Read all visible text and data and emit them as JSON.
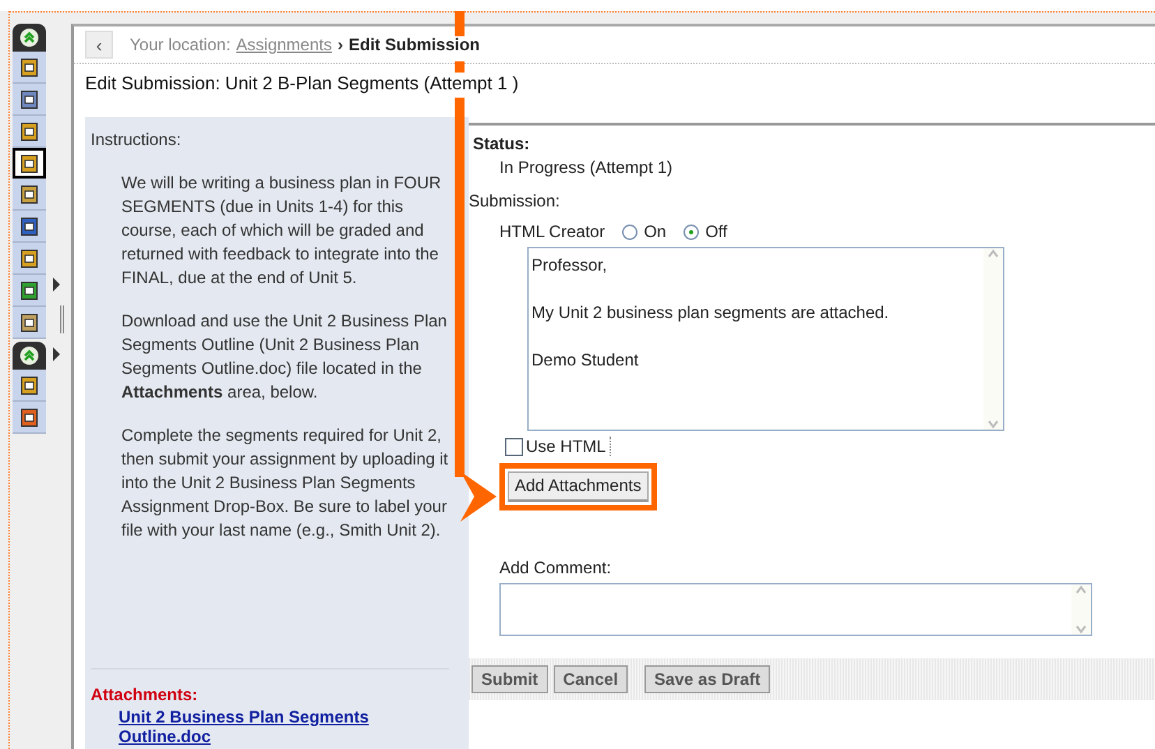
{
  "sidebar": {
    "groups": [
      {
        "items": [
          {
            "selected": false
          },
          {
            "selected": false
          },
          {
            "selected": false
          },
          {
            "selected": true
          },
          {
            "selected": false
          },
          {
            "selected": false
          },
          {
            "selected": false
          },
          {
            "selected": false
          },
          {
            "selected": false
          }
        ]
      },
      {
        "items": [
          {
            "selected": false
          },
          {
            "selected": false
          }
        ]
      }
    ]
  },
  "breadcrumb": {
    "back": "‹",
    "label": "Your location:",
    "link": "Assignments",
    "separator": "›",
    "current": "Edit Submission"
  },
  "page_title": "Edit Submission: Unit 2 B-Plan Segments (Attempt 1 )",
  "instructions": {
    "heading": "Instructions:",
    "paragraphs": [
      "We will be writing a business plan in FOUR SEGMENTS (due in Units 1-4) for this course, each of which will be graded and returned with feedback to integrate into the FINAL, due at the end of Unit 5.",
      "Download and use the Unit 2 Business Plan Segments Outline (Unit 2 Business Plan Segments Outline.doc) file located in the **Attachments** area, below.",
      "Complete the segments required for Unit 2, then submit your assignment by uploading it into the Unit 2 Business Plan Segments Assignment Drop-Box. Be sure to label your file with your last name (e.g., Smith Unit 2)."
    ]
  },
  "attachments": {
    "heading": "Attachments:",
    "files": [
      "Unit 2 Business Plan Segments Outline.doc"
    ]
  },
  "form": {
    "status_label": "Status:",
    "status_value": "In Progress (Attempt 1)",
    "submission_label": "Submission:",
    "html_creator": {
      "label": "HTML Creator",
      "options": [
        {
          "label": "On",
          "selected": false
        },
        {
          "label": "Off",
          "selected": true
        }
      ]
    },
    "message": "Professor,\n\nMy Unit 2 business plan segments are attached.\n\nDemo Student",
    "use_html": {
      "label": "Use HTML",
      "checked": false
    },
    "add_attachments": "Add Attachments",
    "comment_label": "Add Comment:",
    "buttons": [
      "Submit",
      "Cancel",
      "Save as Draft"
    ]
  }
}
